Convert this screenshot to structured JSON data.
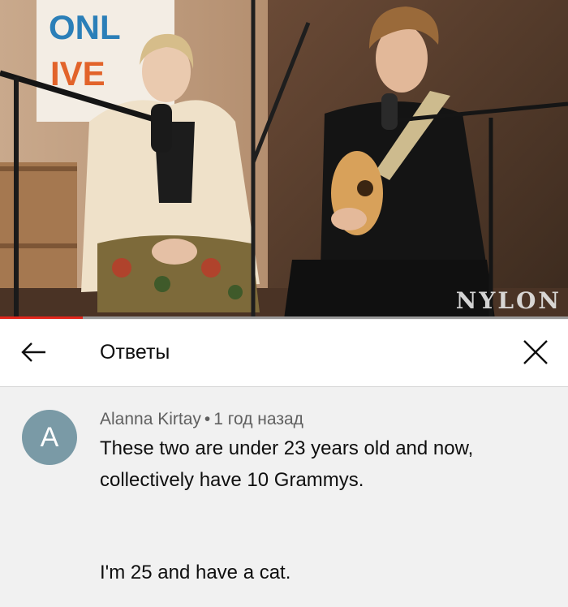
{
  "video": {
    "watermark": "NYLON",
    "poster_text_row1": "ONL",
    "poster_text_row2": "IVE",
    "progress_percent": 14.6,
    "progress_color": "#e1251b"
  },
  "header": {
    "back_icon": "arrow-left-icon",
    "title": "Ответы",
    "close_icon": "close-icon"
  },
  "comment": {
    "avatar_letter": "A",
    "avatar_color": "#7a9aa6",
    "author": "Alanna Kirtay",
    "separator": "•",
    "time": "1 год назад",
    "lines": [
      "These two are under 23 years old and now,",
      "collectively have 10 Grammys.",
      "I'm 25 and have a cat."
    ]
  }
}
